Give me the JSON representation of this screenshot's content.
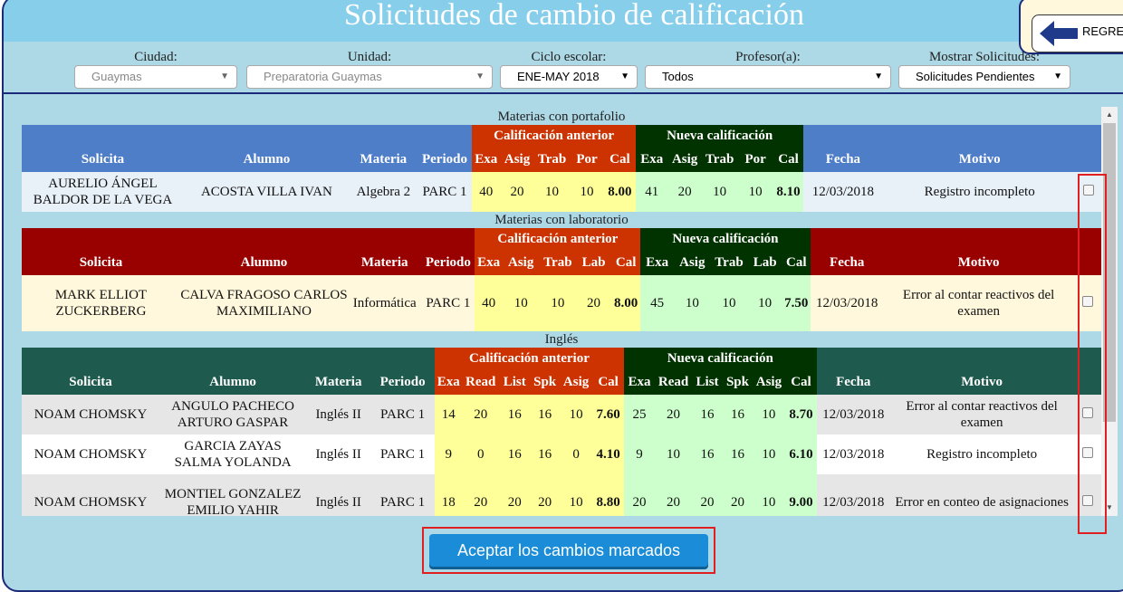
{
  "header": {
    "title": "Solicitudes de cambio de calificación",
    "back_label": "REGRESAR"
  },
  "filters": {
    "ciudad": {
      "label": "Ciudad:",
      "value": "Guaymas"
    },
    "unidad": {
      "label": "Unidad:",
      "value": "Preparatoria Guaymas"
    },
    "ciclo": {
      "label": "Ciclo escolar:",
      "value": "ENE-MAY 2018"
    },
    "profesor": {
      "label": "Profesor(a):",
      "value": "Todos"
    },
    "mostrar": {
      "label": "Mostrar Solicitudes:",
      "value": "Solicitudes Pendientes"
    }
  },
  "portafolio": {
    "caption": "Materias con portafolio",
    "group_prev": "Calificación anterior",
    "group_new": "Nueva calificación",
    "columns": [
      "Solicita",
      "Alumno",
      "Materia",
      "Periodo",
      "Exa",
      "Asig",
      "Trab",
      "Por",
      "Cal",
      "Exa",
      "Asig",
      "Trab",
      "Por",
      "Cal",
      "Fecha",
      "Motivo"
    ],
    "rows": [
      [
        "AURELIO ÁNGEL BALDOR DE LA VEGA",
        "ACOSTA VILLA IVAN",
        "Algebra 2",
        "PARC 1",
        "40",
        "20",
        "10",
        "10",
        "8.00",
        "41",
        "20",
        "10",
        "10",
        "8.10",
        "12/03/2018",
        "Registro incompleto"
      ]
    ]
  },
  "laboratorio": {
    "caption": "Materias con laboratorio",
    "group_prev": "Calificación anterior",
    "group_new": "Nueva calificación",
    "columns": [
      "Solicita",
      "Alumno",
      "Materia",
      "Periodo",
      "Exa",
      "Asig",
      "Trab",
      "Lab",
      "Cal",
      "Exa",
      "Asig",
      "Trab",
      "Lab",
      "Cal",
      "Fecha",
      "Motivo"
    ],
    "rows": [
      [
        "MARK ELLIOT ZUCKERBERG",
        "CALVA FRAGOSO CARLOS MAXIMILIANO",
        "Informática",
        "PARC 1",
        "40",
        "10",
        "10",
        "20",
        "8.00",
        "45",
        "10",
        "10",
        "10",
        "7.50",
        "12/03/2018",
        "Error al contar reactivos del examen"
      ]
    ]
  },
  "ingles": {
    "caption": "Inglés",
    "group_prev": "Calificación anterior",
    "group_new": "Nueva calificación",
    "columns": [
      "Solicita",
      "Alumno",
      "Materia",
      "Periodo",
      "Exa",
      "Read",
      "List",
      "Spk",
      "Asig",
      "Cal",
      "Exa",
      "Read",
      "List",
      "Spk",
      "Asig",
      "Cal",
      "Fecha",
      "Motivo"
    ],
    "rows": [
      [
        "NOAM CHOMSKY",
        "ANGULO PACHECO ARTURO GASPAR",
        "Inglés II",
        "PARC 1",
        "14",
        "20",
        "16",
        "16",
        "10",
        "7.60",
        "25",
        "20",
        "16",
        "16",
        "10",
        "8.70",
        "12/03/2018",
        "Error al contar reactivos del examen"
      ],
      [
        "NOAM CHOMSKY",
        "GARCIA ZAYAS SALMA YOLANDA",
        "Inglés II",
        "PARC 1",
        "9",
        "0",
        "16",
        "16",
        "0",
        "4.10",
        "9",
        "10",
        "16",
        "16",
        "10",
        "6.10",
        "12/03/2018",
        "Registro incompleto"
      ],
      [
        "NOAM CHOMSKY",
        "MONTIEL GONZALEZ EMILIO YAHIR",
        "Inglés II",
        "PARC 1",
        "18",
        "20",
        "20",
        "20",
        "10",
        "8.80",
        "20",
        "20",
        "20",
        "20",
        "10",
        "9.00",
        "12/03/2018",
        "Error en conteo de asignaciones"
      ]
    ]
  },
  "accept_button": "Aceptar los cambios marcados"
}
